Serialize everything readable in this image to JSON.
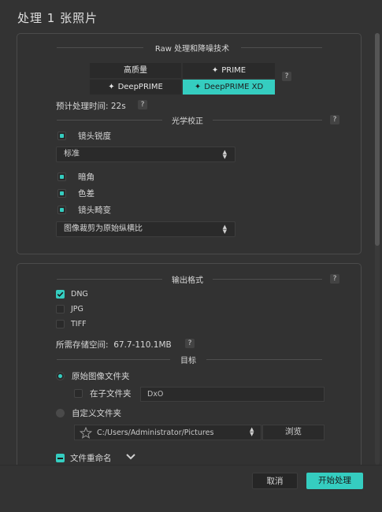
{
  "window": {
    "title": "处理 1 张照片"
  },
  "raw_section": {
    "title": "Raw 处理和降噪技术",
    "modes": [
      {
        "label": "高质量",
        "active": false,
        "icon": ""
      },
      {
        "label": "PRIME",
        "active": false,
        "icon": "sparkle-icon"
      },
      {
        "label": "DeepPRIME",
        "active": false,
        "icon": "sparkle-icon"
      },
      {
        "label": "DeepPRIME XD",
        "active": true,
        "icon": "sparkle-icon"
      }
    ],
    "help": "?",
    "estimate": "预计处理时间: 22s",
    "estimate_help": "?"
  },
  "optics_section": {
    "title": "光学校正",
    "help": "?",
    "lens_sharpness": "镜头锐度",
    "sharpness_select": "标准",
    "vignetting": "暗角",
    "chromatic": "色差",
    "distortion": "镜头畸变",
    "crop_select": "图像裁剪为原始纵横比"
  },
  "output_section": {
    "title": "输出格式",
    "help": "?",
    "formats": [
      {
        "label": "DNG",
        "checked": true
      },
      {
        "label": "JPG",
        "checked": false
      },
      {
        "label": "TIFF",
        "checked": false
      }
    ],
    "storage": "所需存储空间:  67.7-110.1MB",
    "storage_help": "?"
  },
  "target_section": {
    "title": "目标",
    "original_folder": "原始图像文件夹",
    "subfolder_label": "在子文件夹",
    "subfolder_value": "DxO",
    "custom_folder": "自定义文件夹",
    "custom_path": "C:/Users/Administrator/Pictures",
    "browse": "浏览"
  },
  "rename": {
    "label": "文件重命名"
  },
  "footer": {
    "cancel": "取消",
    "start": "开始处理"
  },
  "colors": {
    "accent": "#35cdc0",
    "background": "#333333"
  }
}
